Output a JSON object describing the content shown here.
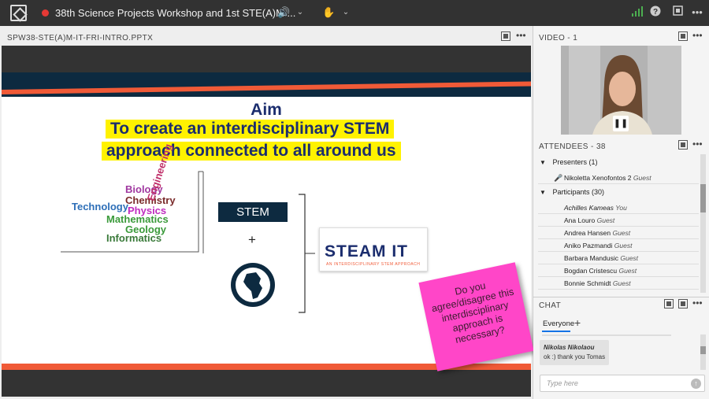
{
  "topbar": {
    "meeting_title": "38th Science Projects Workshop and 1st STE(A)M ...",
    "icons": [
      "adobe-connect-logo",
      "record-indicator",
      "speaker-icon",
      "raise-hand-icon",
      "signal-icon",
      "help-icon",
      "fullscreen-icon",
      "more-icon"
    ]
  },
  "share_pod": {
    "title": "SPW38-STE(A)M-IT-FRI-INTRO.PPTX"
  },
  "slide": {
    "heading": "Aim",
    "line1": "To create an interdisciplinary STEM",
    "line2": "approach connected to all around us",
    "words": {
      "biology": "Biology",
      "technology": "Technology",
      "chemistry": "Chemistry",
      "physics": "Physics",
      "engineering": "Engineering",
      "mathematics": "Mathematics",
      "geology": "Geology",
      "informatics": "Informatics"
    },
    "stem_label": "STEM",
    "plus": "+",
    "steam_logo": "STEAM IT",
    "steam_sub": "AN INTERDISCIPLINARY STEM APPROACH",
    "sticky_text": "Do you agree/disagree this interdisciplinary approach is necessary?"
  },
  "video_pod": {
    "title": "VIDEO - 1"
  },
  "attendees": {
    "title": "ATTENDEES - 38",
    "presenters_label": "Presenters (1)",
    "presenter": {
      "name": "Nikoletta Xenofontos 2",
      "role": "Guest"
    },
    "participants_label": "Participants (30)",
    "participants": [
      {
        "name": "Achilles Kameas",
        "role": "You"
      },
      {
        "name": "Ana Louro",
        "role": "Guest"
      },
      {
        "name": "Andrea Hansen",
        "role": "Guest"
      },
      {
        "name": "Aniko Pazmandi",
        "role": "Guest"
      },
      {
        "name": "Barbara Mandusic",
        "role": "Guest"
      },
      {
        "name": "Bogdan Cristescu",
        "role": "Guest"
      },
      {
        "name": "Bonnie Schmidt",
        "role": "Guest"
      }
    ]
  },
  "chat": {
    "title": "CHAT",
    "tab": "Everyone",
    "add_tab": "+",
    "message": {
      "author": "Nikolas Nikolaou",
      "text": "ok :) thank you Tomas"
    },
    "input_placeholder": "Type here"
  },
  "colors": {
    "topbar": "#323232",
    "slide_navy": "#0d2a40",
    "slide_orange": "#f05a37",
    "highlight": "#fff200",
    "sticky": "#ff46c8",
    "accent_blue": "#1473e6"
  }
}
